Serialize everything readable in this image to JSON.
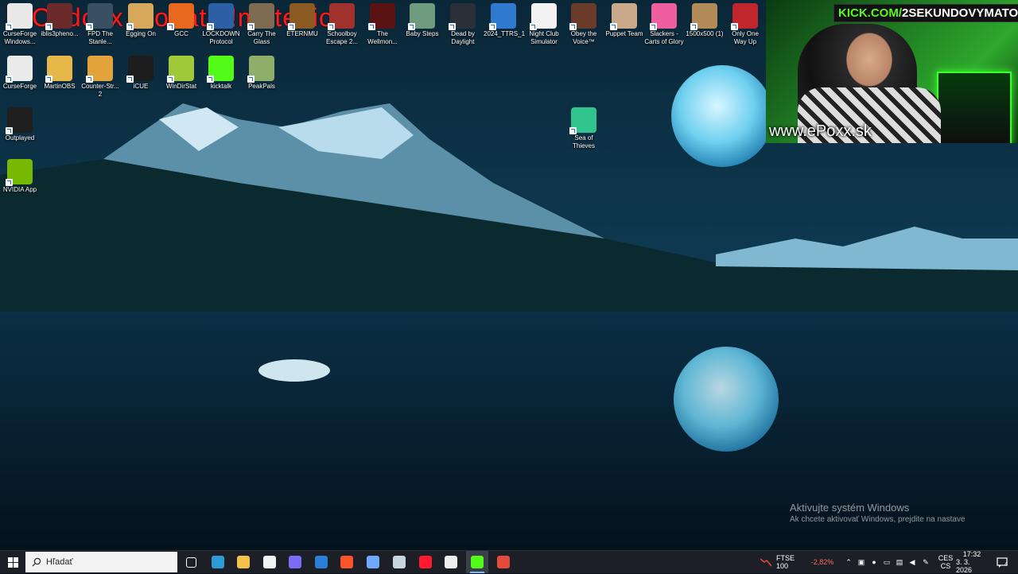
{
  "overlay": {
    "commands_text": "!DC !doxx !donate !matebio",
    "kick_prefix": "KICK.COM/",
    "kick_channel": "2SEKUNDOVYMATO",
    "website": "www.ePoxx.sk"
  },
  "desktop_icons": [
    {
      "label": "CurseForge\nWindows...",
      "icon": "curseforge-icon",
      "color": "#e8e8e8"
    },
    {
      "label": "iblis3pheno...",
      "icon": "game-icon",
      "color": "#6b2b2b"
    },
    {
      "label": "FPD The\nStanle...",
      "icon": "game-icon",
      "color": "#3b4f62"
    },
    {
      "label": "Egging On",
      "icon": "game-icon",
      "color": "#d8a85a"
    },
    {
      "label": "GCC",
      "icon": "game-icon",
      "color": "#e8691d"
    },
    {
      "label": "LOCKDOWN\nProtocol",
      "icon": "game-icon",
      "color": "#2d5fa5"
    },
    {
      "label": "Carry The\nGlass",
      "icon": "game-icon",
      "color": "#7d6b52"
    },
    {
      "label": "ETERNMU",
      "icon": "game-icon",
      "color": "#8a5a22"
    },
    {
      "label": "Schoolboy\nEscape 2...",
      "icon": "game-icon",
      "color": "#a0312c"
    },
    {
      "label": "The\nWellmon...",
      "icon": "game-icon",
      "color": "#5a1212"
    },
    {
      "label": "Baby Steps",
      "icon": "game-icon",
      "color": "#6f9b7e"
    },
    {
      "label": "Dead by\nDaylight",
      "icon": "game-icon",
      "color": "#2a2f38"
    },
    {
      "label": "2024_TTRS_1",
      "icon": "file-icon",
      "color": "#2f7ad0"
    },
    {
      "label": "Night Club\nSimulator",
      "icon": "game-icon",
      "color": "#f2f2f2"
    },
    {
      "label": "Obey the\nVoice™",
      "icon": "game-icon",
      "color": "#6a3a2a"
    },
    {
      "label": "Puppet Team",
      "icon": "game-icon",
      "color": "#c9a98a"
    },
    {
      "label": "Slackers -\nCarts of Glory",
      "icon": "game-icon",
      "color": "#ef5fa0"
    },
    {
      "label": "1500x500 (1)",
      "icon": "image-icon",
      "color": "#b38b5a"
    },
    {
      "label": "Only One\nWay Up",
      "icon": "game-icon",
      "color": "#c0262c"
    },
    {
      "label": "CurseForge",
      "icon": "curseforge-icon",
      "color": "#eaeaea"
    },
    {
      "label": "MartinOBS",
      "icon": "folder-icon",
      "color": "#e6b84a"
    },
    {
      "label": "Counter-Str...\n2",
      "icon": "game-icon",
      "color": "#e3a33b"
    },
    {
      "label": "iCUE",
      "icon": "icue-icon",
      "color": "#1d1d1d"
    },
    {
      "label": "WinDirStat",
      "icon": "windirstat-icon",
      "color": "#9fc93a"
    },
    {
      "label": "kicktalk",
      "icon": "kick-icon",
      "color": "#53fc18"
    },
    {
      "label": "PeakPals",
      "icon": "game-icon",
      "color": "#8fae6a"
    },
    {
      "label": "Outplayed",
      "icon": "outplayed-icon",
      "color": "#1f1f1f"
    },
    {
      "label": "NVIDIA App",
      "icon": "nvidia-icon",
      "color": "#76b900"
    },
    {
      "label": "Sea of\nThieves",
      "icon": "sea-of-thieves-icon",
      "color": "#31c48d"
    }
  ],
  "activation": {
    "title": "Aktivujte systém Windows",
    "subtitle": "Ak chcete aktivovať Windows, prejdite na nastave"
  },
  "taskbar": {
    "search_placeholder": "Hľadať",
    "pinned": [
      {
        "name": "task-view-icon",
        "color": "#ffffff"
      },
      {
        "name": "edge-icon",
        "color": "#2e9bd6"
      },
      {
        "name": "file-explorer-icon",
        "color": "#f2c24a"
      },
      {
        "name": "store-icon",
        "color": "#f3f3f3"
      },
      {
        "name": "copilot-icon",
        "color": "#7b6cf6"
      },
      {
        "name": "mail-icon",
        "color": "#2b7fd6"
      },
      {
        "name": "brave-icon",
        "color": "#fb542b"
      },
      {
        "name": "app-icon",
        "color": "#6fa8ff"
      },
      {
        "name": "steam-icon",
        "color": "#c7d5e0"
      },
      {
        "name": "opera-icon",
        "color": "#ff1b2d"
      },
      {
        "name": "obs-icon",
        "color": "#eeeeee"
      },
      {
        "name": "kick-icon",
        "color": "#53fc18"
      },
      {
        "name": "recorder-icon",
        "color": "#e34b3b"
      }
    ],
    "stock_name": "FTSE 100",
    "stock_change": "-2,82%",
    "lang_top": "CES",
    "lang_bottom": "CS",
    "time": "17:32",
    "date": "3. 3. 2026",
    "notification_count": "4"
  }
}
